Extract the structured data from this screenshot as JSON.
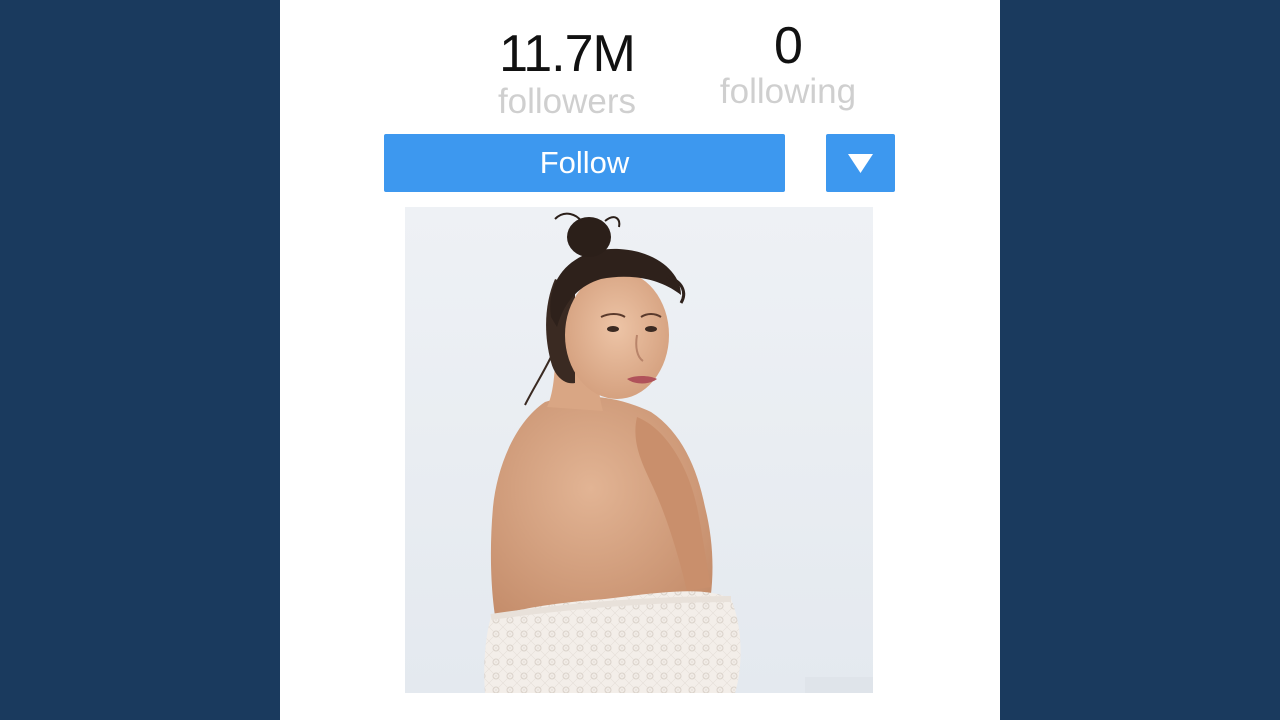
{
  "profile": {
    "followers_count": "11.7M",
    "followers_label": "followers",
    "following_count": "0",
    "following_label": "following"
  },
  "actions": {
    "follow_label": "Follow",
    "dropdown_icon": "triangle-down-icon"
  },
  "colors": {
    "background": "#1a3a5e",
    "panel": "#ffffff",
    "button": "#3d98ef",
    "button_text": "#ffffff",
    "count_text": "#111111",
    "label_text": "#cfcfcf"
  },
  "photo": {
    "subject": "portrait of a woman with hair in a bun, looking over her bare shoulder, wearing a white lace garment, against a pale sky"
  }
}
